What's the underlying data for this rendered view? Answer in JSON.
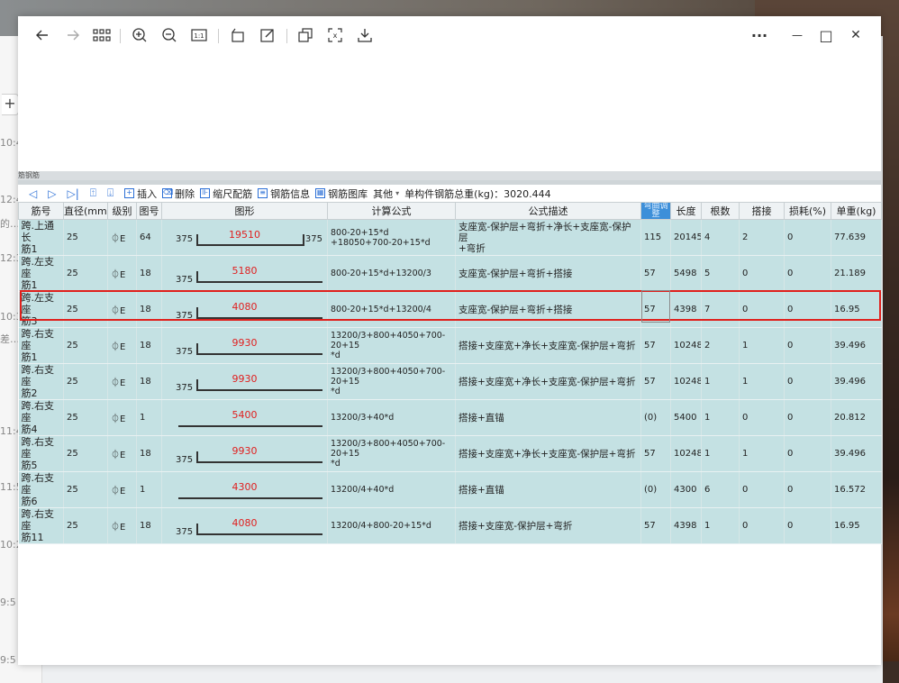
{
  "background": {
    "times": [
      "10:4",
      "12:4",
      "12:3",
      "10:3",
      "11:4",
      "11:5",
      "10:2",
      "9:5",
      "9:5"
    ],
    "left_fragments": [
      "的…",
      "差…"
    ]
  },
  "viewer": {
    "toolbar_icons": [
      "back-arrow-icon",
      "forward-arrow-icon",
      "grid-view-icon",
      "zoom-in-icon",
      "zoom-out-icon",
      "actual-size-icon",
      "rotate-icon",
      "edit-icon",
      "copy-icon",
      "ocr-icon",
      "save-icon"
    ],
    "more_label": "···",
    "minimize_label": "—",
    "maximize_label": "□",
    "close_label": "✕"
  },
  "app": {
    "header_fragment": "筋钢筋",
    "toolbar": {
      "insert": "插入",
      "delete": "删除",
      "ruler": "缩尺配筋",
      "rebar_info": "钢筋信息",
      "rebar_lib": "钢筋图库",
      "other": "其他",
      "total_label": "单构件钢筋总重(kg)：3020.444"
    },
    "columns": [
      "筋号",
      "直径(mm)",
      "级别",
      "图号",
      "图形",
      "计算公式",
      "公式描述",
      "弯曲调整",
      "长度",
      "根数",
      "搭接",
      "损耗(%)",
      "单重(kg)"
    ],
    "rows": [
      {
        "jh_a": "跨.上通长",
        "jh_b": "筋1",
        "d": "25",
        "grade": "⏀E",
        "fig": "64",
        "left": "375",
        "val": "19510",
        "right": "375",
        "formula": "800-20+15*d\n+18050+700-20+15*d",
        "desc": "支座宽-保护层+弯折+净长+支座宽-保护层\n+弯折",
        "bend": "115",
        "len": "20145",
        "count": "4",
        "lap": "2",
        "loss": "0",
        "weight": "77.639",
        "kind": "u"
      },
      {
        "jh_a": "跨.左支座",
        "jh_b": "筋1",
        "d": "25",
        "grade": "⏀E",
        "fig": "18",
        "left": "375",
        "val": "5180",
        "right": "",
        "formula": "800-20+15*d+13200/3",
        "desc": "支座宽-保护层+弯折+搭接",
        "bend": "57",
        "len": "5498",
        "count": "5",
        "lap": "0",
        "loss": "0",
        "weight": "21.189",
        "kind": "l"
      },
      {
        "jh_a": "跨.左支座",
        "jh_b": "筋3",
        "d": "25",
        "grade": "⏀E",
        "fig": "18",
        "left": "375",
        "val": "4080",
        "right": "",
        "formula": "800-20+15*d+13200/4",
        "desc": "支座宽-保护层+弯折+搭接",
        "bend": "57",
        "len": "4398",
        "count": "7",
        "lap": "0",
        "loss": "0",
        "weight": "16.95",
        "kind": "l"
      },
      {
        "jh_a": "跨.右支座",
        "jh_b": "筋1",
        "d": "25",
        "grade": "⏀E",
        "fig": "18",
        "left": "375",
        "val": "9930",
        "right": "",
        "formula": "13200/3+800+4050+700-20+15\n*d",
        "desc": "搭接+支座宽+净长+支座宽-保护层+弯折",
        "bend": "57",
        "len": "10248",
        "count": "2",
        "lap": "1",
        "loss": "0",
        "weight": "39.496",
        "kind": "l"
      },
      {
        "jh_a": "跨.右支座",
        "jh_b": "筋2",
        "d": "25",
        "grade": "⏀E",
        "fig": "18",
        "left": "375",
        "val": "9930",
        "right": "",
        "formula": "13200/3+800+4050+700-20+15\n*d",
        "desc": "搭接+支座宽+净长+支座宽-保护层+弯折",
        "bend": "57",
        "len": "10248",
        "count": "1",
        "lap": "1",
        "loss": "0",
        "weight": "39.496",
        "kind": "l"
      },
      {
        "jh_a": "跨.右支座",
        "jh_b": "筋4",
        "d": "25",
        "grade": "⏀E",
        "fig": "1",
        "left": "",
        "val": "5400",
        "right": "",
        "formula": "13200/3+40*d",
        "desc": "搭接+直锚",
        "bend": "(0)",
        "len": "5400",
        "count": "1",
        "lap": "0",
        "loss": "0",
        "weight": "20.812",
        "kind": "s"
      },
      {
        "jh_a": "跨.右支座",
        "jh_b": "筋5",
        "d": "25",
        "grade": "⏀E",
        "fig": "18",
        "left": "375",
        "val": "9930",
        "right": "",
        "formula": "13200/3+800+4050+700-20+15\n*d",
        "desc": "搭接+支座宽+净长+支座宽-保护层+弯折",
        "bend": "57",
        "len": "10248",
        "count": "1",
        "lap": "1",
        "loss": "0",
        "weight": "39.496",
        "kind": "l"
      },
      {
        "jh_a": "跨.右支座",
        "jh_b": "筋6",
        "d": "25",
        "grade": "⏀E",
        "fig": "1",
        "left": "",
        "val": "4300",
        "right": "",
        "formula": "13200/4+40*d",
        "desc": "搭接+直锚",
        "bend": "(0)",
        "len": "4300",
        "count": "6",
        "lap": "0",
        "loss": "0",
        "weight": "16.572",
        "kind": "s"
      },
      {
        "jh_a": "跨.右支座",
        "jh_b": "筋11",
        "d": "25",
        "grade": "⏀E",
        "fig": "18",
        "left": "375",
        "val": "4080",
        "right": "",
        "formula": "13200/4+800-20+15*d",
        "desc": "搭接+支座宽-保护层+弯折",
        "bend": "57",
        "len": "4398",
        "count": "1",
        "lap": "0",
        "loss": "0",
        "weight": "16.95",
        "kind": "l"
      }
    ]
  }
}
